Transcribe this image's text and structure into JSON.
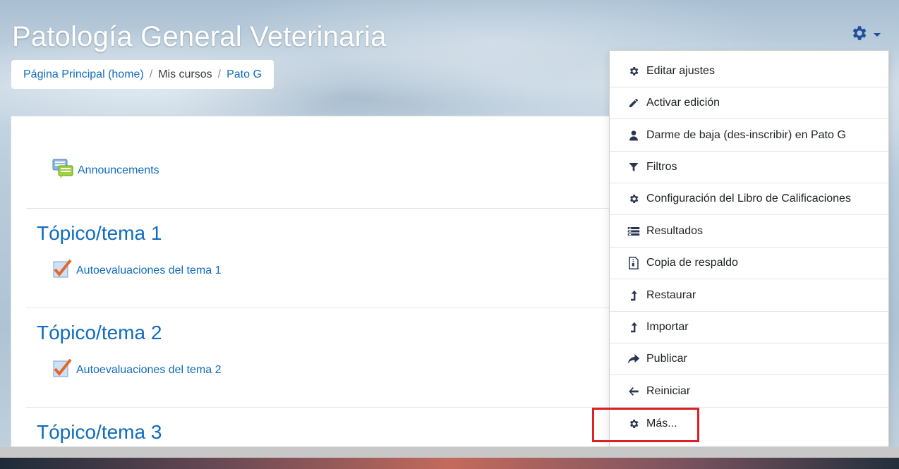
{
  "header": {
    "title": "Patología General Veterinaria"
  },
  "breadcrumb": {
    "items": [
      "Página Principal (home)",
      "Mis cursos",
      "Pato G"
    ],
    "separator": "/"
  },
  "course": {
    "announcement": "Announcements",
    "sections": [
      {
        "title": "Tópico/tema 1",
        "activity": "Autoevaluaciones del tema 1"
      },
      {
        "title": "Tópico/tema 2",
        "activity": "Autoevaluaciones del tema 2"
      },
      {
        "title": "Tópico/tema 3"
      }
    ]
  },
  "menu": {
    "items": [
      {
        "label": "Editar ajustes",
        "icon": "gear-icon"
      },
      {
        "label": "Activar edición",
        "icon": "pencil-icon"
      },
      {
        "label": "Darme de baja (des-inscribir) en Pato G",
        "icon": "user-icon"
      },
      {
        "label": "Filtros",
        "icon": "filter-icon"
      },
      {
        "label": "Configuración del Libro de Calificaciones",
        "icon": "gear-icon"
      },
      {
        "label": "Resultados",
        "icon": "list-icon"
      },
      {
        "label": "Copia de respaldo",
        "icon": "file-archive-icon"
      },
      {
        "label": "Restaurar",
        "icon": "level-up-icon"
      },
      {
        "label": "Importar",
        "icon": "level-up-icon"
      },
      {
        "label": "Publicar",
        "icon": "share-icon"
      },
      {
        "label": "Reiniciar",
        "icon": "arrow-left-icon"
      },
      {
        "label": "Más...",
        "icon": "gear-icon"
      }
    ]
  },
  "colors": {
    "link": "#0f6cbf",
    "menu_icon": "#2a3553",
    "highlight": "#e01f26"
  }
}
